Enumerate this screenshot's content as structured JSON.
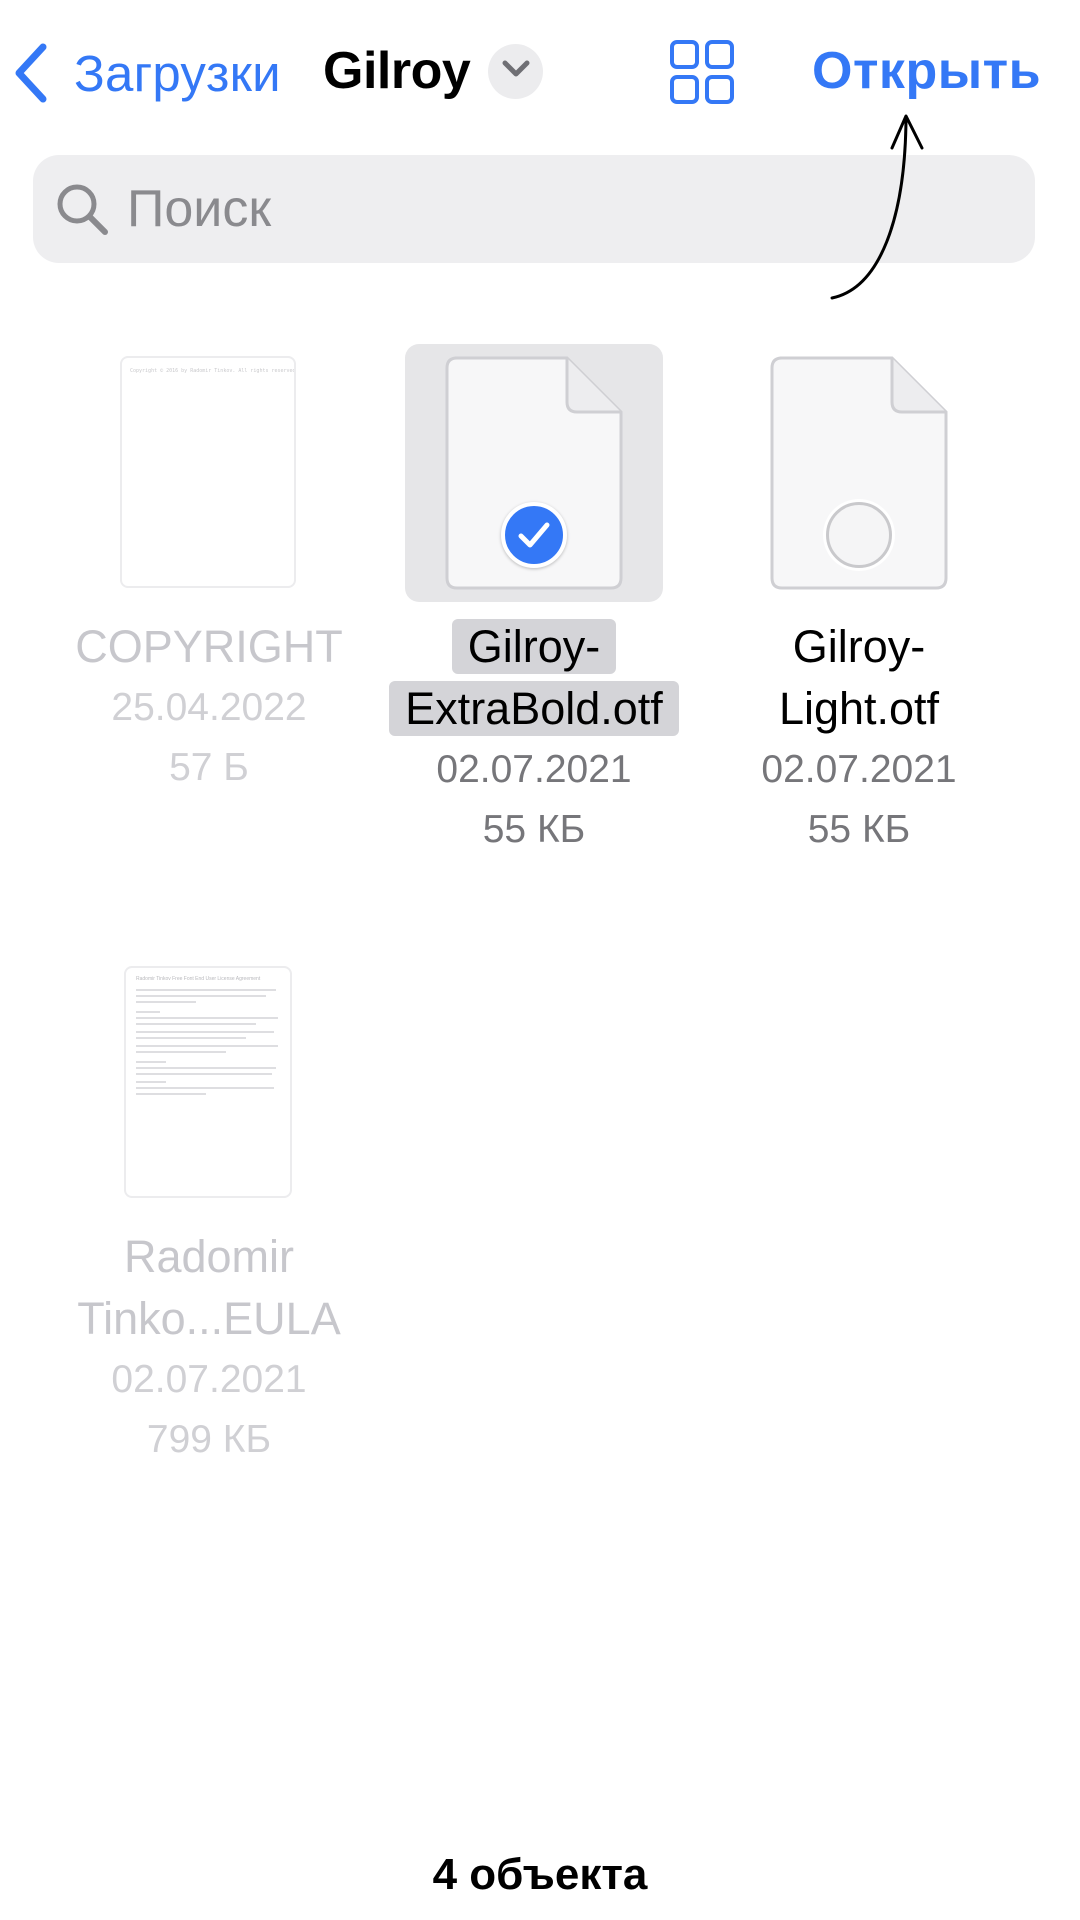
{
  "header": {
    "back_label": "Загрузки",
    "folder_title": "Gilroy",
    "open_label": "Открыть",
    "accent_color": "#3478f6"
  },
  "search": {
    "placeholder": "Поиск",
    "value": ""
  },
  "files": [
    {
      "name": "COPYRIGHT",
      "date": "25.04.2022",
      "size": "57 Б",
      "state": "dimmed",
      "preview_text": "Copyright © 2016 by Radomir Tinkov. All rights reserved."
    },
    {
      "name_line1": "Gilroy-",
      "name_line2": "ExtraBold.otf",
      "date": "02.07.2021",
      "size": "55 КБ",
      "state": "selected",
      "icon": "checkmark-circle-icon"
    },
    {
      "name_line1": "Gilroy-",
      "name_line2": "Light.otf",
      "date": "02.07.2021",
      "size": "55 КБ",
      "state": "unselected",
      "icon": "empty-circle-icon"
    },
    {
      "name_line1": "Radomir",
      "name_line2": "Tinko...EULA",
      "date": "02.07.2021",
      "size": "799 КБ",
      "state": "dimmed",
      "preview_title": "Radomir Tinkov Free Font End User License Agreement"
    }
  ],
  "footer": {
    "count_label": "4 объекта"
  }
}
